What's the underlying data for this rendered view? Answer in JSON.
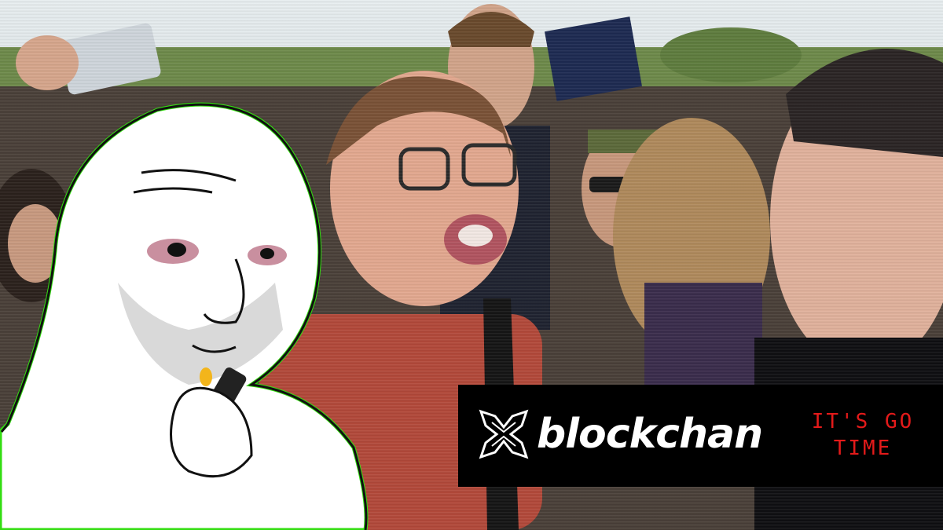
{
  "scene": {
    "colors": {
      "banner_bg": "#000000",
      "brand_text": "#ffffff",
      "tagline_text": "#e31a1a",
      "sticker_outline": "#33dd11"
    }
  },
  "banner": {
    "brand_name": "blockchan",
    "logo_icon": "blockchan-x-logo-icon",
    "tagline_line1": "IT'S GO",
    "tagline_line2": "TIME"
  }
}
